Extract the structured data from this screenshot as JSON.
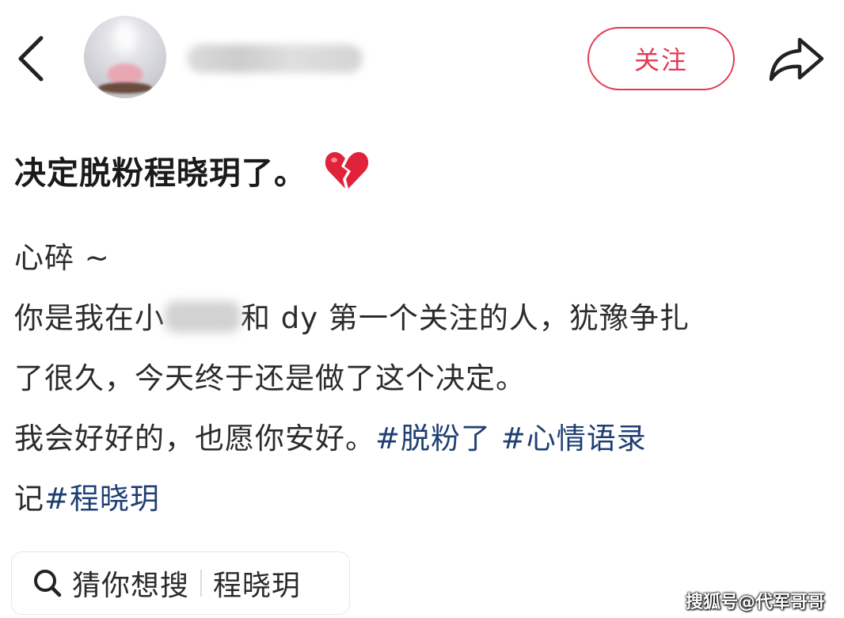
{
  "header": {
    "back_icon": "chevron-left-icon",
    "avatar_icon": "avatar",
    "username_blurred": "",
    "follow_label": "关注",
    "share_icon": "share-icon",
    "accent_color": "#e23b54"
  },
  "post": {
    "title": "决定脱粉程晓玥了。",
    "title_emoji": "broken-heart-icon",
    "body_lines": [
      {
        "parts": [
          "心碎 ~"
        ]
      },
      {
        "before": "你是我在小",
        "after": "和 dy 第一个关注的人，犹豫争扎"
      },
      {
        "text": "了很久，今天终于还是做了这个决定。"
      },
      {
        "text": "我会好好的，也愿你安好。",
        "tag1": "#脱粉了",
        "tag2": "#心情语录"
      },
      {
        "text": "记",
        "tag3": "#程晓玥"
      }
    ],
    "tag_color": "#1f3f73"
  },
  "search_suggestion": {
    "icon": "search-icon",
    "label": "猜你想搜",
    "term": "程晓玥"
  },
  "watermark": "搜狐号@代军哥哥"
}
